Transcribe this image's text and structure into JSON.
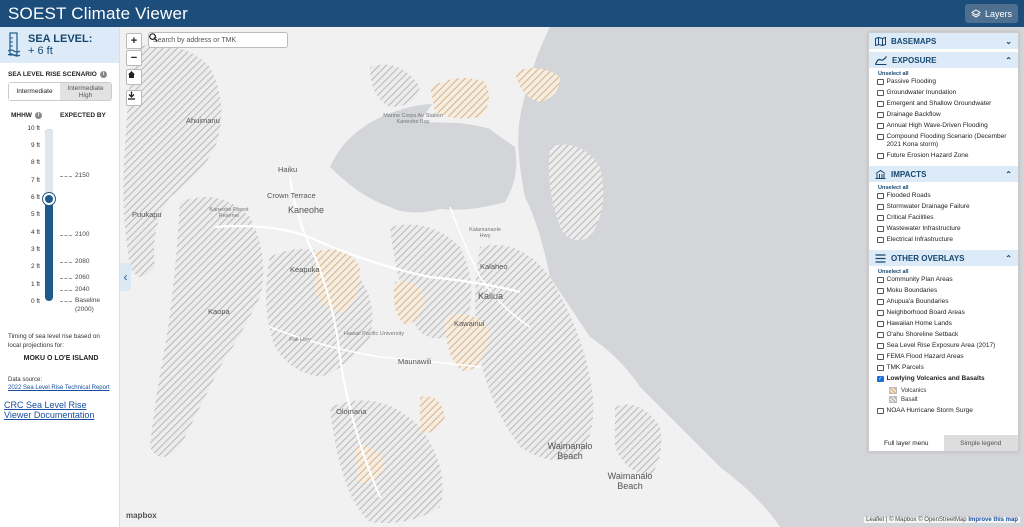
{
  "header": {
    "title": "SOEST Climate Viewer",
    "layers_label": "Layers"
  },
  "sidebar": {
    "sea_level_title": "SEA LEVEL:",
    "sea_level_value": "+ 6 ft",
    "scenario_label": "SEA LEVEL RISE SCENARIO",
    "scenario_options": [
      "Intermediate",
      "Intermediate High"
    ],
    "scenario_selected": "Intermediate",
    "mhhw_label": "MHHW",
    "expected_label": "EXPECTED BY",
    "feet": [
      "10 ft",
      "9 ft",
      "8 ft",
      "7 ft",
      "6 ft",
      "5 ft",
      "4 ft",
      "3 ft",
      "2 ft",
      "1 ft",
      "0 ft"
    ],
    "selected_ft": 6,
    "years": [
      "2150",
      "2100",
      "2080",
      "2060",
      "2040",
      "Baseline",
      "(2000)"
    ],
    "timing_text": "Timing of sea level rise based on local projections for:",
    "island": "MOKU O LO'E ISLAND",
    "data_source_label": "Data source:",
    "data_source_link": "2022 Sea Level Rise Technical Report",
    "doc_link": "CRC Sea Level Rise Viewer Documentation"
  },
  "map": {
    "search_placeholder": "Search by address or TMK",
    "zoom_in": "+",
    "zoom_out": "−",
    "places": {
      "marine_corps": "Marine Corps Air Station Kaneohe Bay",
      "kaneohe": "Kaneohe",
      "kailua": "Kailua",
      "ahuimanu": "Ahuimanu",
      "haiku": "Haiku",
      "crown_terrace": "Crown Terrace",
      "puukapu": "Puukapu",
      "keapuka": "Keapuka",
      "kaneohe_forest": "Kaneohe Forest Reserve",
      "hawaii_pacific": "Hawaii Pacific University",
      "maunawili": "Maunawili",
      "kalaheo": "Kalaheo",
      "kaopa": "Kaopa",
      "kawainui": "Kawainui",
      "olomana": "Olomana",
      "waimanalo_beach_1": "Waimanalo Beach",
      "waimanalo_beach_2": "Waimanalo Beach",
      "pali_hwy": "Pali Hwy",
      "kalanianaole": "Kalanianaole Hwy"
    },
    "mapbox_logo": "mapbox",
    "attribution": {
      "leaflet": "Leaflet",
      "mapbox": "© Mapbox",
      "osm": "© OpenStreetMap",
      "improve": "Improve this map"
    }
  },
  "layers_panel": {
    "basemaps": "BASEMAPS",
    "exposure": "EXPOSURE",
    "impacts": "IMPACTS",
    "other_overlays": "OTHER OVERLAYS",
    "unselect_all": "Unselect all",
    "exposure_items": [
      "Passive Flooding",
      "Groundwater Inundation",
      "Emergent and Shallow Groundwater",
      "Drainage Backflow",
      "Annual High Wave-Driven Flooding",
      "Compound Flooding Scenario (December 2021 Kona storm)",
      "Future Erosion Hazard Zone"
    ],
    "impacts_items": [
      "Flooded Roads",
      "Stormwater Drainage Failure",
      "Critical Facilities",
      "Wastewater Infrastructure",
      "Electrical Infrastructure"
    ],
    "overlay_items": [
      "Community Plan Areas",
      "Moku Boundaries",
      "Ahupua'a Boundaries",
      "Neighborhood Board Areas",
      "Hawaiian Home Lands",
      "O'ahu Shoreline Setback",
      "Sea Level Rise Exposure Area (2017)",
      "FEMA Flood Hazard Areas",
      "TMK Parcels",
      "Lowlying Volcanics and Basalts"
    ],
    "legend": [
      "Volcanics",
      "Basalt"
    ],
    "last_item": "NOAA Hurricane Storm Surge",
    "tab_full": "Full layer menu",
    "tab_simple": "Simple legend",
    "colors": {
      "volcanics": "#e4b98a",
      "basalt": "#cfcfcf",
      "accent": "#16466f"
    }
  }
}
